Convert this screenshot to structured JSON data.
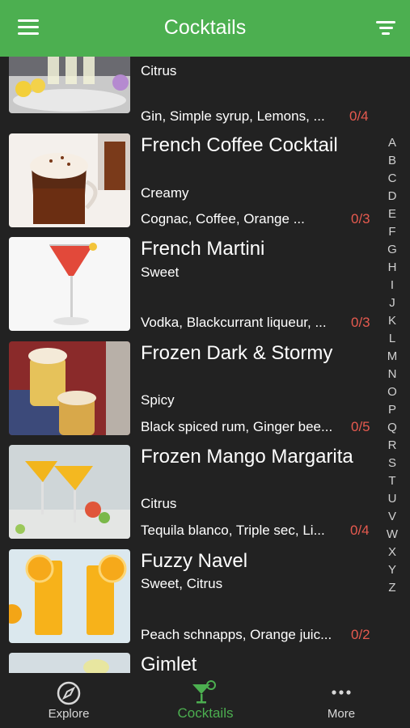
{
  "header": {
    "title": "Cocktails",
    "menu_icon": "hamburger-menu-icon",
    "filter_icon": "filter-icon"
  },
  "list": {
    "items": [
      {
        "name": "",
        "flavor": "Citrus",
        "ingredients": "Gin, Simple syrup, Lemons, ...",
        "count": "0/4"
      },
      {
        "name": "French Coffee Cocktail",
        "flavor": "Creamy",
        "ingredients": "Cognac, Coffee, Orange ...",
        "count": "0/3"
      },
      {
        "name": "French Martini",
        "flavor": "Sweet",
        "ingredients": "Vodka, Blackcurrant liqueur, ...",
        "count": "0/3"
      },
      {
        "name": "Frozen Dark & Stormy",
        "flavor": "Spicy",
        "ingredients": "Black spiced rum, Ginger bee...",
        "count": "0/5"
      },
      {
        "name": "Frozen Mango Margarita",
        "flavor": "Citrus",
        "ingredients": "Tequila blanco, Triple sec, Li...",
        "count": "0/4"
      },
      {
        "name": "Fuzzy Navel",
        "flavor": "Sweet, Citrus",
        "ingredients": "Peach schnapps, Orange juic...",
        "count": "0/2"
      },
      {
        "name": "Gimlet",
        "flavor": "",
        "ingredients": "",
        "count": ""
      }
    ]
  },
  "alphabet": [
    "A",
    "B",
    "C",
    "D",
    "E",
    "F",
    "G",
    "H",
    "I",
    "J",
    "K",
    "L",
    "M",
    "N",
    "O",
    "P",
    "Q",
    "R",
    "S",
    "T",
    "U",
    "V",
    "W",
    "X",
    "Y",
    "Z"
  ],
  "tabs": [
    {
      "label": "Explore",
      "icon": "compass-icon",
      "active": false
    },
    {
      "label": "Cocktails",
      "icon": "cocktail-glass-icon",
      "active": true
    },
    {
      "label": "More",
      "icon": "more-dots-icon",
      "active": false
    }
  ],
  "colors": {
    "accent": "#4caf50",
    "count": "#e65a4f",
    "background": "#222222"
  }
}
